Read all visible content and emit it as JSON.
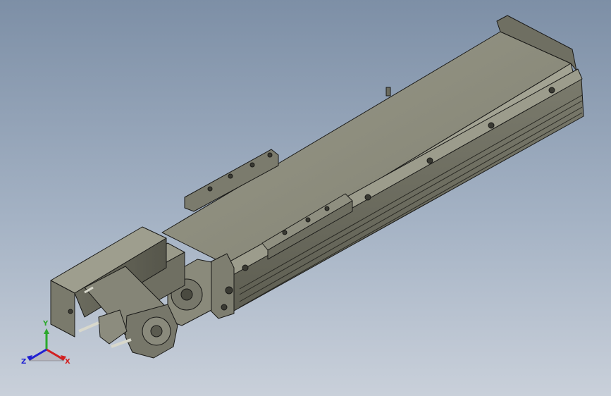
{
  "viewport": {
    "background_top": "#7d8fa6",
    "background_bottom": "#c9d0da",
    "model_color": "#8a8a7a",
    "edge_color": "#1a1a18"
  },
  "triad": {
    "x_label": "X",
    "y_label": "Y",
    "z_label": "Z",
    "x_color": "#d22020",
    "y_color": "#2ca82c",
    "z_color": "#2020d2"
  }
}
